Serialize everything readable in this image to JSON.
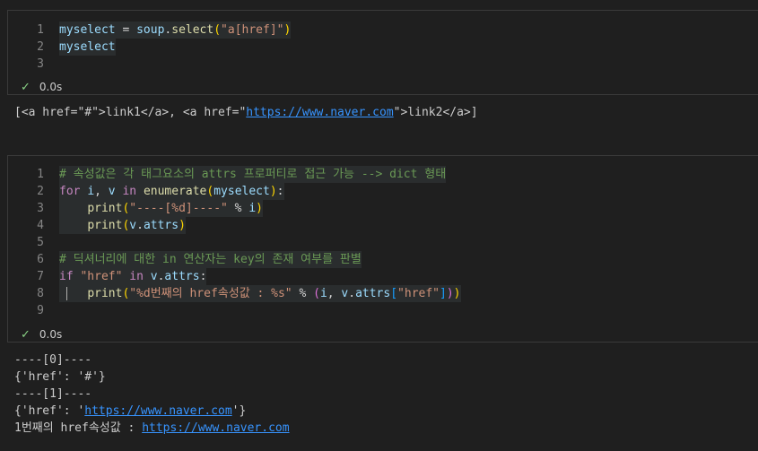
{
  "cells": [
    {
      "lines": [
        {
          "n": "1",
          "tokens": [
            [
              "var",
              "myselect"
            ],
            [
              "op",
              " = "
            ],
            [
              "var",
              "soup"
            ],
            [
              "op",
              "."
            ],
            [
              "fn",
              "select"
            ],
            [
              "pun",
              "("
            ],
            [
              "str",
              "\"a[href]\""
            ],
            [
              "pun",
              ")"
            ]
          ]
        },
        {
          "n": "2",
          "tokens": [
            [
              "var",
              "myselect"
            ]
          ]
        },
        {
          "n": "3",
          "tokens": []
        }
      ],
      "status": {
        "time": "0.0s"
      },
      "output": [
        [
          [
            "txt",
            "[<a href=\"#\">link1</a>, <a href=\""
          ],
          [
            "link",
            "https://www.naver.com"
          ],
          [
            "txt",
            "\">link2</a>]"
          ]
        ]
      ]
    },
    {
      "lines": [
        {
          "n": "1",
          "tokens": [
            [
              "cm",
              "# 속성값은 각 태그요소의 attrs 프로퍼티로 접근 가능 --> dict 형태"
            ]
          ]
        },
        {
          "n": "2",
          "tokens": [
            [
              "kw",
              "for"
            ],
            [
              "op",
              " "
            ],
            [
              "var",
              "i"
            ],
            [
              "op",
              ", "
            ],
            [
              "var",
              "v"
            ],
            [
              "op",
              " "
            ],
            [
              "kw",
              "in"
            ],
            [
              "op",
              " "
            ],
            [
              "fn",
              "enumerate"
            ],
            [
              "pun",
              "("
            ],
            [
              "var",
              "myselect"
            ],
            [
              "pun",
              ")"
            ],
            [
              "op",
              ":"
            ]
          ]
        },
        {
          "n": "3",
          "tokens": [
            [
              "op",
              "    "
            ],
            [
              "fn",
              "print"
            ],
            [
              "pun",
              "("
            ],
            [
              "str",
              "\"----[%d]----\""
            ],
            [
              "op",
              " % "
            ],
            [
              "var",
              "i"
            ],
            [
              "pun",
              ")"
            ]
          ]
        },
        {
          "n": "4",
          "tokens": [
            [
              "op",
              "    "
            ],
            [
              "fn",
              "print"
            ],
            [
              "pun",
              "("
            ],
            [
              "var",
              "v"
            ],
            [
              "op",
              "."
            ],
            [
              "var",
              "attrs"
            ],
            [
              "pun",
              ")"
            ]
          ]
        },
        {
          "n": "5",
          "tokens": []
        },
        {
          "n": "6",
          "tokens": [
            [
              "cm",
              "# 딕셔너리에 대한 in 연산자는 key의 존재 여부를 판별"
            ]
          ]
        },
        {
          "n": "7",
          "tokens": [
            [
              "kw",
              "if"
            ],
            [
              "op",
              " "
            ],
            [
              "str",
              "\"href\""
            ],
            [
              "op",
              " "
            ],
            [
              "kw",
              "in"
            ],
            [
              "op",
              " "
            ],
            [
              "var",
              "v"
            ],
            [
              "op",
              "."
            ],
            [
              "var",
              "attrs"
            ],
            [
              "op",
              ":"
            ]
          ]
        },
        {
          "n": "8",
          "tokens": [
            [
              "op",
              "    "
            ],
            [
              "fn",
              "print"
            ],
            [
              "pun",
              "("
            ],
            [
              "str",
              "\"%d번째의 href속성값 : %s\""
            ],
            [
              "op",
              " % "
            ],
            [
              "pun2",
              "("
            ],
            [
              "var",
              "i"
            ],
            [
              "op",
              ", "
            ],
            [
              "var",
              "v"
            ],
            [
              "op",
              "."
            ],
            [
              "var",
              "attrs"
            ],
            [
              "pun3",
              "["
            ],
            [
              "str",
              "\"href\""
            ],
            [
              "pun3",
              "]"
            ],
            [
              "pun2",
              ")"
            ],
            [
              "pun",
              ")"
            ]
          ]
        },
        {
          "n": "9",
          "tokens": []
        }
      ],
      "status": {
        "time": "0.0s"
      },
      "output": [
        [
          [
            "txt",
            "----[0]----"
          ]
        ],
        [
          [
            "txt",
            "{'href': '#'}"
          ]
        ],
        [
          [
            "txt",
            "----[1]----"
          ]
        ],
        [
          [
            "txt",
            "{'href': '"
          ],
          [
            "link",
            "https://www.naver.com"
          ],
          [
            "txt",
            "'}"
          ]
        ],
        [
          [
            "txt",
            "1번째의 href속성값 : "
          ],
          [
            "link",
            "https://www.naver.com"
          ]
        ]
      ]
    }
  ]
}
